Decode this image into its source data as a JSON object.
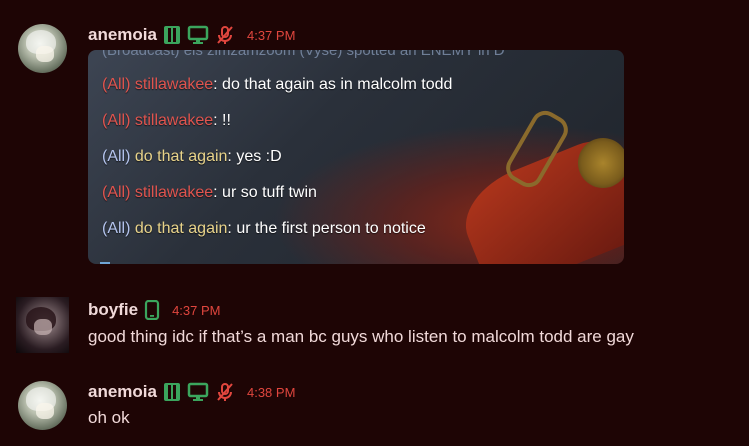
{
  "messages": [
    {
      "user": "anemoia",
      "time": "4:37 PM",
      "badges": [
        "mobile-icon",
        "monitor-icon",
        "muted-mic-icon"
      ],
      "colors": {
        "badge_green": "#3ba55d",
        "badge_red": "#e0463e"
      }
    },
    {
      "user": "boyfie",
      "time": "4:37 PM",
      "text": "good thing idc if that’s a man bc guys who listen to malcolm todd are gay",
      "badges": [
        "mobile-icon"
      ]
    },
    {
      "user": "anemoia",
      "time": "4:38 PM",
      "text": "oh ok",
      "badges": [
        "mobile-icon",
        "monitor-icon",
        "muted-mic-icon"
      ]
    }
  ],
  "attachment": {
    "clipped_line": "(Broadcast) els zimzamzoom (Vyse) spotted an ENEMY in D",
    "lines": [
      {
        "prefix": "(All) ",
        "name": "stillawakee",
        "sep": ": ",
        "text": "do that again as in malcolm todd",
        "prefix_color": "red"
      },
      {
        "prefix": "(All) ",
        "name": "stillawakee",
        "sep": ": ",
        "text": "!!",
        "prefix_color": "red"
      },
      {
        "prefix": "(All) ",
        "name": "do that again",
        "sep": ": ",
        "text": "yes :D",
        "prefix_color": "blue"
      },
      {
        "prefix": "(All) ",
        "name": "stillawakee",
        "sep": ": ",
        "text": "ur so tuff twin",
        "prefix_color": "red"
      },
      {
        "prefix": "(All) ",
        "name": "do that again",
        "sep": ": ",
        "text": "ur the first person to notice",
        "prefix_color": "blue"
      }
    ]
  }
}
